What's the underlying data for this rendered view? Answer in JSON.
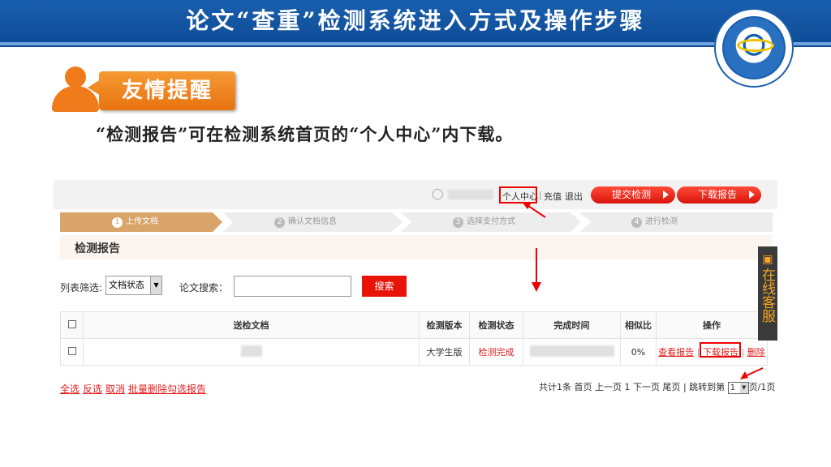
{
  "slide": {
    "title": "论文“查重”检测系统进入方式及操作步骤",
    "reminder_label": "友情提醒",
    "tip": "“检测报告”可在检测系统首页的“个人中心”内下载。"
  },
  "header": {
    "personal_center": "个人中心",
    "recharge": "充值",
    "logout": "退出",
    "submit_btn": "提交检测",
    "download_btn": "下载报告"
  },
  "steps": [
    {
      "num": "1",
      "label": "上传文档",
      "active": true
    },
    {
      "num": "2",
      "label": "确认文档信息"
    },
    {
      "num": "3",
      "label": "选择支付方式"
    },
    {
      "num": "4",
      "label": "进行检测"
    }
  ],
  "page": {
    "title": "检测报告",
    "filter_label": "列表筛选:",
    "filter_value": "文档状态",
    "search_label": "论文搜索：",
    "search_btn": "搜索"
  },
  "table": {
    "headers": [
      "送检文档",
      "检测版本",
      "检测状态",
      "完成时间",
      "相似比",
      "操作"
    ],
    "row": {
      "version": "大学生版",
      "status": "检测完成",
      "similarity": "0%",
      "view": "查看报告",
      "download": "下载报告",
      "sep": "|",
      "delete": "删除"
    }
  },
  "footer": {
    "select_all": "全选",
    "invert": "反选",
    "cancel": "取消",
    "batch_delete": "批量删除勾选报告",
    "pager_prefix": "共计1条 首页 上一页 1 下一页 尾页 | 跳转到第",
    "pager_value": "1",
    "pager_suffix": "页/1页"
  },
  "side_tab": {
    "text": "在线客服"
  },
  "colors": {
    "header_blue": "#1a5fae",
    "accent_orange": "#f07b1b",
    "accent_red": "#e81408"
  }
}
